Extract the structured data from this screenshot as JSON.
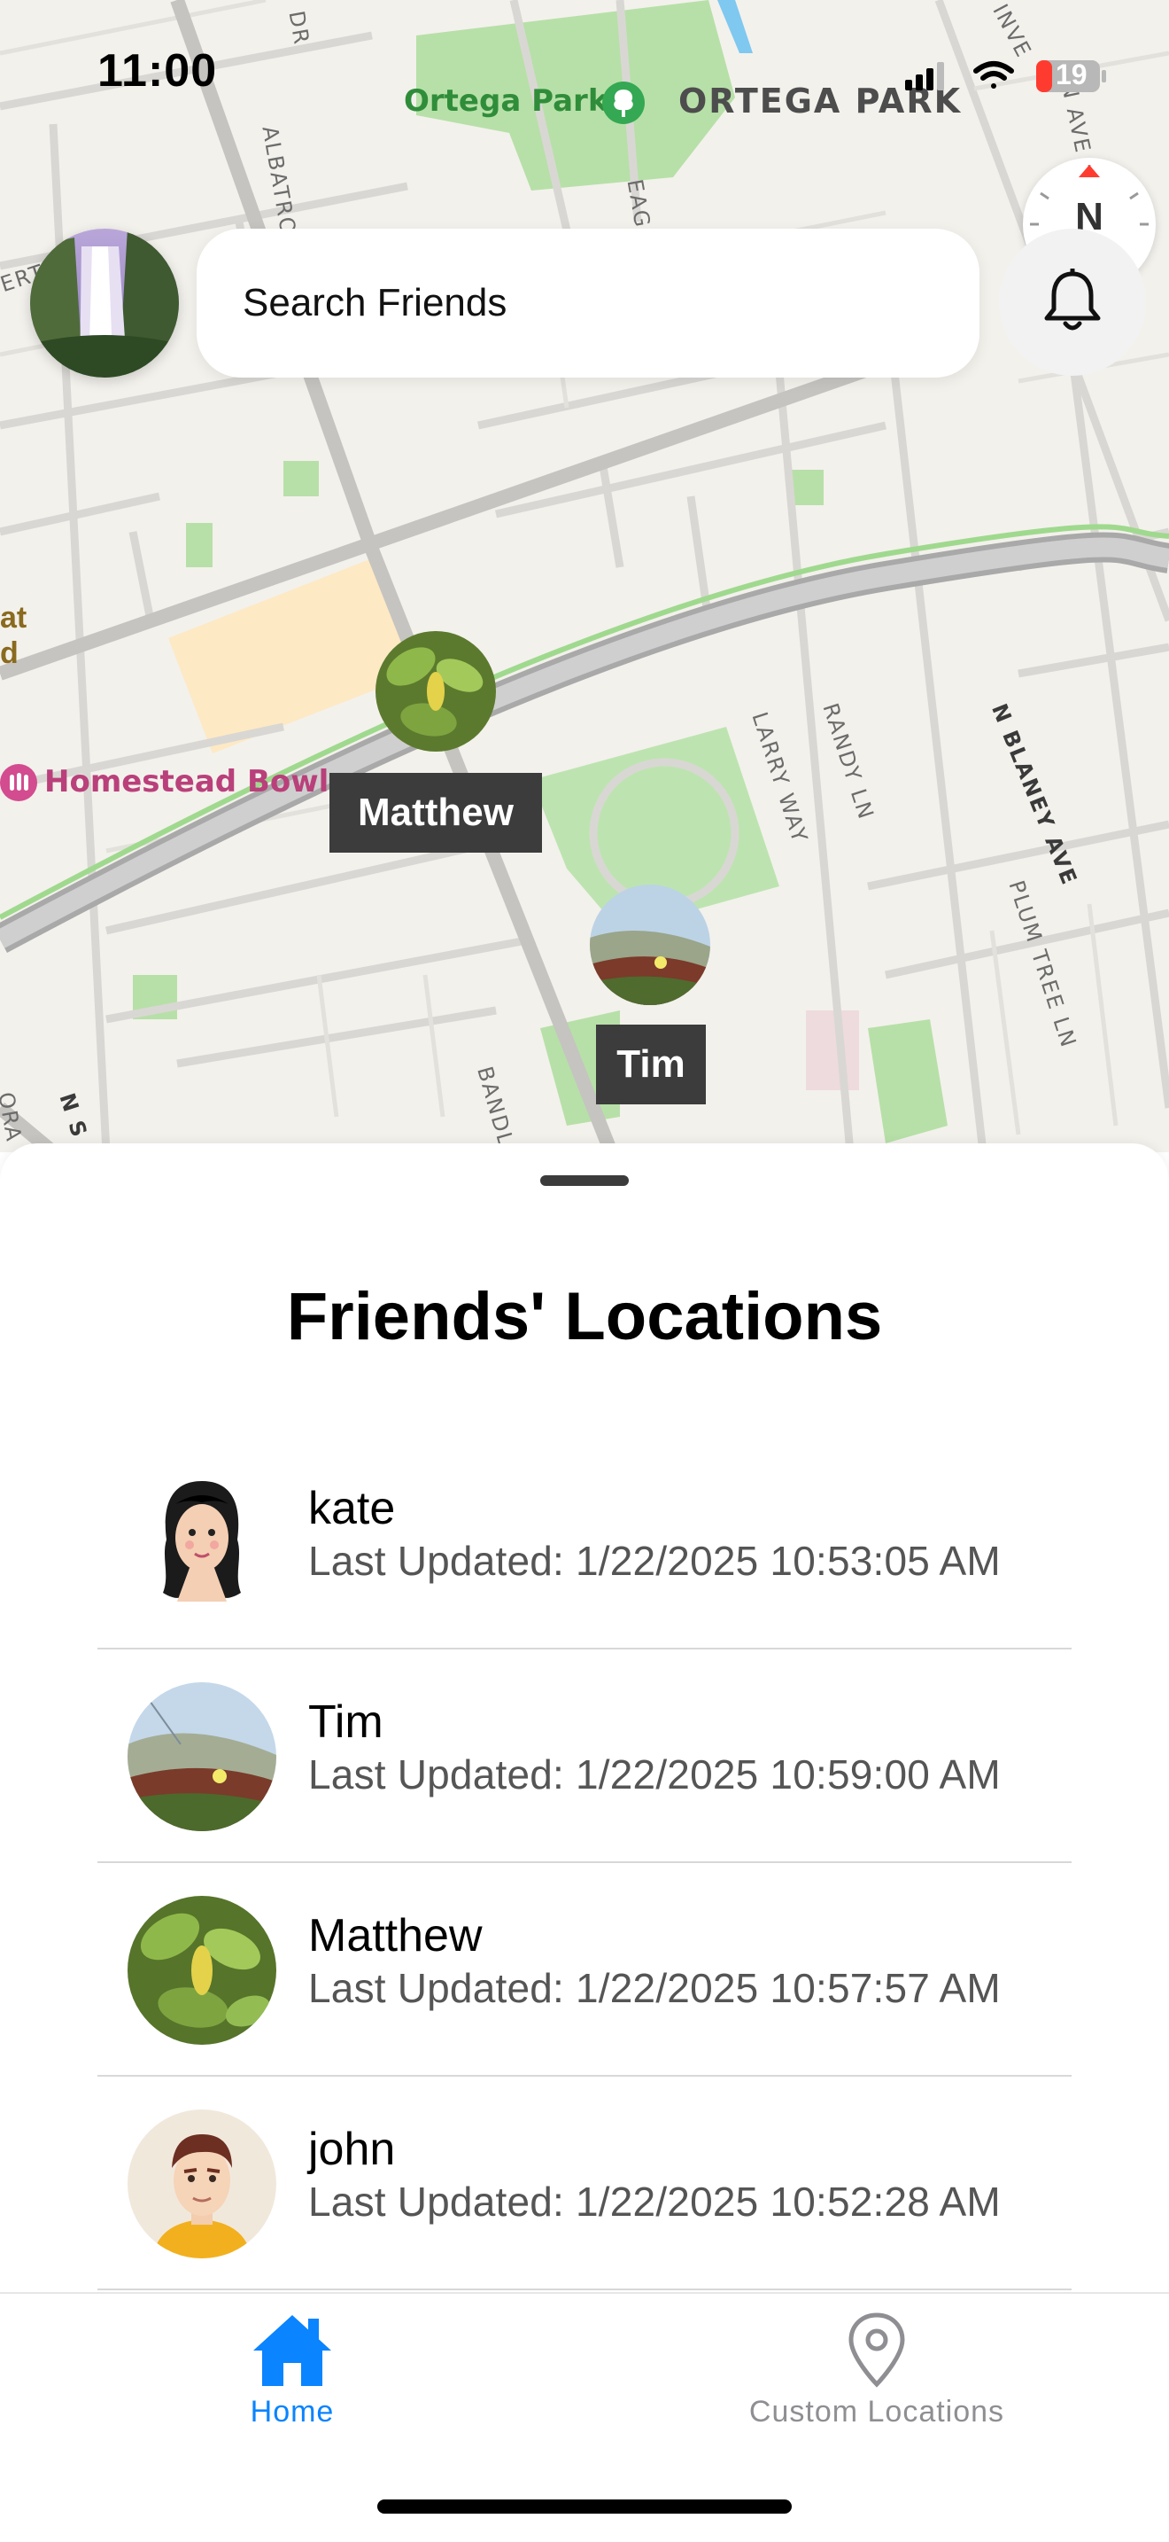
{
  "status_bar": {
    "time": "11:00",
    "battery": "19"
  },
  "map": {
    "labels": {
      "ortega_park": "Ortega Park",
      "ortega_park_big": "ORTEGA PARK",
      "homestead_bowl": "Homestead Bowl",
      "albatross": "ALBATRO",
      "dr": "DR",
      "larry_way": "LARRY WAY",
      "randy_ln": "RANDY LN",
      "n_blaney_ave": "N BLANEY AVE",
      "plum_tree_ln": "PLUM TREE LN",
      "inverness": "INVE",
      "n_ave": "N AVE",
      "bandl": "BANDL",
      "eag": "EAG",
      "ert": "ERT",
      "at": "at",
      "d": "d",
      "n_s": "N S",
      "ora": "ORA"
    },
    "compass": {
      "letter": "N"
    }
  },
  "header": {
    "search_placeholder": "Search Friends"
  },
  "pins": [
    {
      "name": "Matthew"
    },
    {
      "name": "Tim"
    }
  ],
  "sheet": {
    "title": "Friends' Locations",
    "friends": [
      {
        "name": "kate",
        "updated": "Last Updated: 1/22/2025 10:53:05 AM"
      },
      {
        "name": "Tim",
        "updated": "Last Updated: 1/22/2025 10:59:00 AM"
      },
      {
        "name": "Matthew",
        "updated": "Last Updated: 1/22/2025 10:57:57 AM"
      },
      {
        "name": "john",
        "updated": "Last Updated: 1/22/2025 10:52:28 AM"
      }
    ]
  },
  "tab_bar": {
    "tabs": [
      {
        "label": "Home",
        "icon": "house-icon",
        "active": true
      },
      {
        "label": "Custom Locations",
        "icon": "location-pin-icon",
        "active": false
      }
    ]
  },
  "colors": {
    "accent": "#0a84ff",
    "map_bg": "#f3f1ec",
    "park": "#9fd98e",
    "highway": "#b4b4b4"
  }
}
